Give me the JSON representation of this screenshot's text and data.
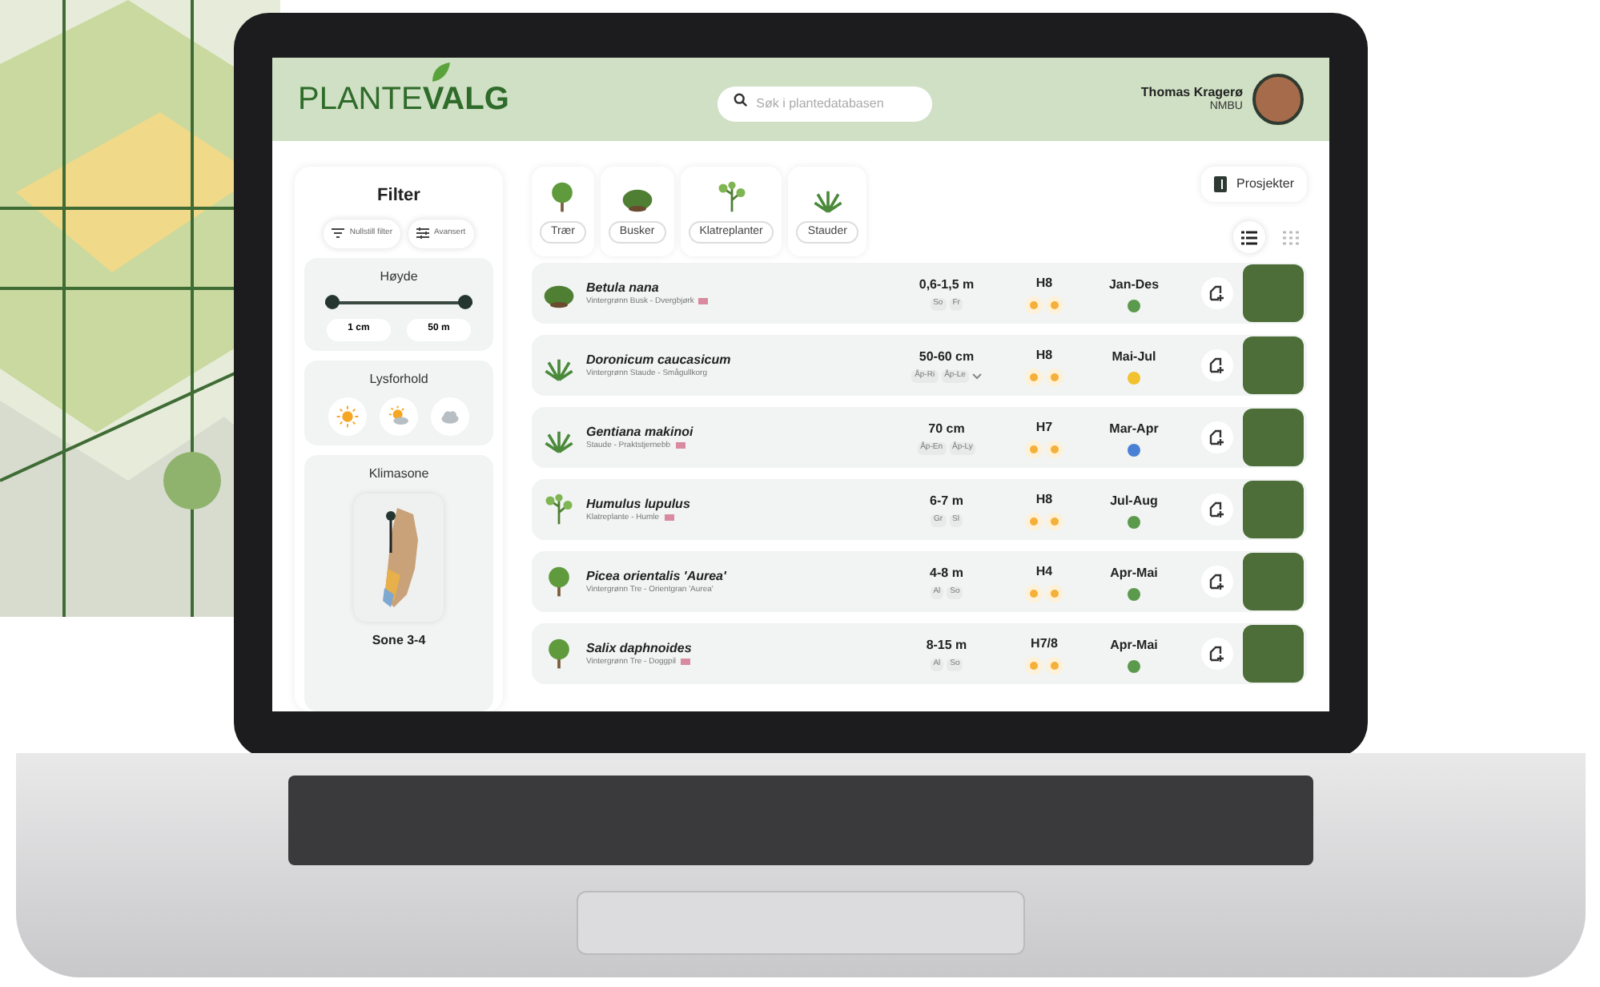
{
  "header": {
    "logo_light": "PLANTE",
    "logo_bold": "VALG",
    "search": {
      "placeholder": "Søk i plantedatabasen"
    },
    "user": {
      "name": "Thomas Kragerø",
      "org": "NMBU"
    }
  },
  "filter": {
    "title": "Filter",
    "buttons": [
      "Nullstill filter",
      "Avansert"
    ],
    "height": {
      "title": "Høyde",
      "level": 1,
      "min": "1 cm",
      "max": "50 m"
    },
    "light": {
      "title": "Lysforhold",
      "options": [
        {
          "kind": "sun",
          "selected": false
        },
        {
          "kind": "partsun",
          "selected": false
        },
        {
          "kind": "shade",
          "selected": false
        }
      ]
    },
    "climate": {
      "title": "Klimasone",
      "zone": "Sone 3-4"
    }
  },
  "categories": [
    {
      "label": "Trær",
      "kind": "tree",
      "selected": false
    },
    {
      "label": "Busker",
      "kind": "bush",
      "selected": false
    },
    {
      "label": "Klatreplanter",
      "kind": "climber",
      "selected": false
    },
    {
      "label": "Stauder",
      "kind": "perennial",
      "selected": false
    }
  ],
  "projects_button": "Prosjekter",
  "views": [
    {
      "kind": "list",
      "selected": true
    },
    {
      "kind": "grid",
      "selected": false
    }
  ],
  "plants": [
    {
      "name": "Betula nana",
      "subtitle": "Vintergrønn Busk - Dvergbjørk",
      "flag": true,
      "kind": "bush",
      "height": "0,6-1,5 m",
      "tags": [
        "So",
        "Fr"
      ],
      "more": false,
      "hardiness": "H8",
      "season": "Jan-Des",
      "color": "#5b9a4c"
    },
    {
      "name": "Doronicum caucasicum",
      "subtitle": "Vintergrønn Staude - Smågullkorg",
      "flag": false,
      "kind": "perennial",
      "height": "50-60 cm",
      "tags": [
        "Åp-Ri",
        "Åp-Le"
      ],
      "more": true,
      "hardiness": "H8",
      "season": "Mai-Jul",
      "color": "#f2c12e"
    },
    {
      "name": "Gentiana makinoi",
      "subtitle": "Staude - Praktstjernebb",
      "flag": true,
      "kind": "perennial",
      "height": "70 cm",
      "tags": [
        "Åp-En",
        "Åp-Ly"
      ],
      "more": false,
      "hardiness": "H7",
      "season": "Mar-Apr",
      "color": "#4a7fd6"
    },
    {
      "name": "Humulus lupulus",
      "subtitle": "Klatreplante - Humle",
      "flag": true,
      "kind": "climber",
      "height": "6-7 m",
      "tags": [
        "Gr",
        "Sl"
      ],
      "more": false,
      "hardiness": "H8",
      "season": "Jul-Aug",
      "color": "#5b9a4c"
    },
    {
      "name": "Picea orientalis 'Aurea'",
      "subtitle": "Vintergrønn Tre - Orientgran 'Aurea'",
      "flag": false,
      "kind": "tree",
      "height": "4-8 m",
      "tags": [
        "Al",
        "So"
      ],
      "more": false,
      "hardiness": "H4",
      "season": "Apr-Mai",
      "color": "#5b9a4c"
    },
    {
      "name": "Salix daphnoides",
      "subtitle": "Vintergrønn Tre - Doggpil",
      "flag": true,
      "kind": "tree",
      "height": "8-15 m",
      "tags": [
        "Al",
        "So"
      ],
      "more": false,
      "hardiness": "H7/8",
      "season": "Apr-Mai",
      "color": "#5b9a4c"
    }
  ]
}
